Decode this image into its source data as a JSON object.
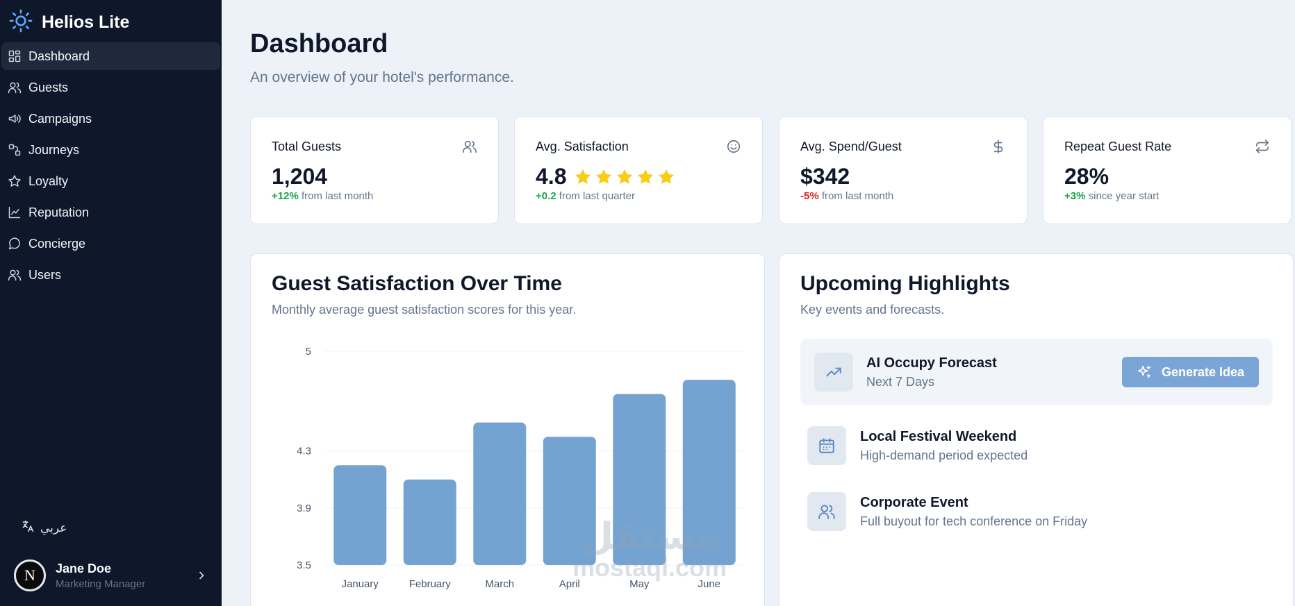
{
  "app": {
    "name": "Helios Lite"
  },
  "sidebar": {
    "items": [
      {
        "label": "Dashboard",
        "icon": "dashboard-icon"
      },
      {
        "label": "Guests",
        "icon": "users-icon"
      },
      {
        "label": "Campaigns",
        "icon": "megaphone-icon"
      },
      {
        "label": "Journeys",
        "icon": "route-icon"
      },
      {
        "label": "Loyalty",
        "icon": "star-icon"
      },
      {
        "label": "Reputation",
        "icon": "line-chart-icon"
      },
      {
        "label": "Concierge",
        "icon": "chat-bubble-icon"
      },
      {
        "label": "Users",
        "icon": "user-icon"
      }
    ],
    "language_label": "عربي",
    "user": {
      "initial": "N",
      "name": "Jane Doe",
      "role": "Marketing Manager"
    }
  },
  "header": {
    "title": "Dashboard",
    "subtitle": "An overview of your hotel's performance."
  },
  "stats": [
    {
      "label": "Total Guests",
      "value": "1,204",
      "delta": "+12%",
      "delta_note": "from last month",
      "icon": "users-icon"
    },
    {
      "label": "Avg. Satisfaction",
      "value": "4.8",
      "rating": 5,
      "delta": "+0.2",
      "delta_note": "from last quarter",
      "icon": "smile-icon"
    },
    {
      "label": "Avg. Spend/Guest",
      "value": "$342",
      "delta": "-5%",
      "delta_note": "from last month",
      "icon": "dollar-icon"
    },
    {
      "label": "Repeat Guest Rate",
      "value": "28%",
      "delta": "+3%",
      "delta_note": "since year start",
      "icon": "repeat-icon"
    }
  ],
  "satisfaction_card": {
    "title": "Guest Satisfaction Over Time",
    "subtitle": "Monthly average guest satisfaction scores for this year."
  },
  "chart_data": {
    "type": "bar",
    "categories": [
      "January",
      "February",
      "March",
      "April",
      "May",
      "June"
    ],
    "values": [
      4.2,
      4.1,
      4.5,
      4.4,
      4.7,
      4.8
    ],
    "yticks": [
      "3.5",
      "3.9",
      "4.3",
      "5"
    ],
    "ylim": [
      3.5,
      5
    ],
    "grid": true,
    "bar_color": "#74a3d2"
  },
  "highlights": {
    "title": "Upcoming Highlights",
    "subtitle": "Key events and forecasts.",
    "featured": {
      "title": "AI Occupy Forecast",
      "subtitle": "Next 7 Days",
      "button": "Generate Idea"
    },
    "items": [
      {
        "title": "Local Festival Weekend",
        "subtitle": "High-demand period expected",
        "icon": "calendar-icon"
      },
      {
        "title": "Corporate Event",
        "subtitle": "Full buyout for tech conference on Friday",
        "icon": "users-icon"
      }
    ]
  },
  "watermark": {
    "arabic": "مستقل",
    "latin": "mostaql.com"
  },
  "colors": {
    "sidebar": "#0f172a",
    "accent": "#74a3d2",
    "positive": "#16a34a",
    "negative": "#dc2626",
    "star": "#facc15"
  }
}
